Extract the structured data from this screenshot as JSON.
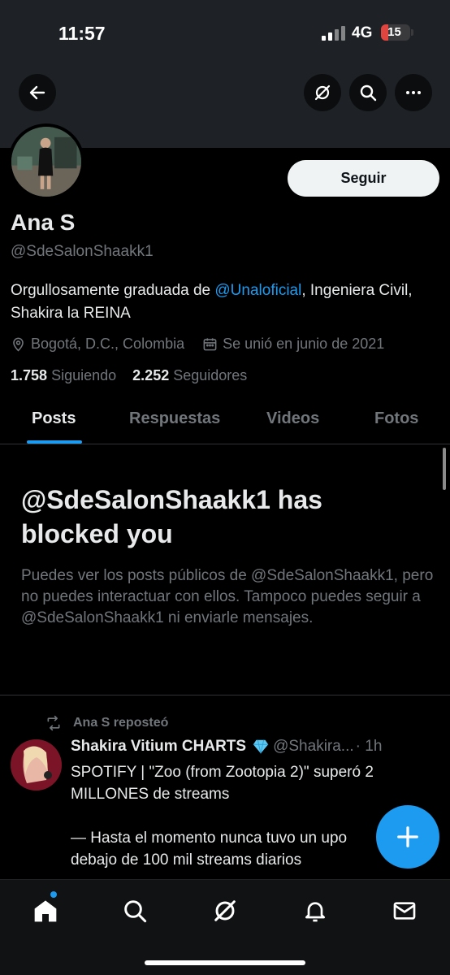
{
  "status_bar": {
    "time": "11:57",
    "network": "4G",
    "battery": "15"
  },
  "profile": {
    "display_name": "Ana S",
    "handle": "@SdeSalonShaakk1",
    "follow_label": "Seguir",
    "bio_prefix": "Orgullosamente graduada de ",
    "bio_mention": "@Unaloficial",
    "bio_suffix": ", Ingeniera Civil, Shakira la REINA",
    "location": "Bogotá, D.C., Colombia",
    "joined": "Se unió en junio de 2021",
    "following_count": "1.758",
    "following_label": "Siguiendo",
    "followers_count": "2.252",
    "followers_label": "Seguidores"
  },
  "tabs": [
    {
      "label": "Posts",
      "active": true
    },
    {
      "label": "Respuestas",
      "active": false
    },
    {
      "label": "Videos",
      "active": false
    },
    {
      "label": "Fotos",
      "active": false
    }
  ],
  "blocked": {
    "title": "@SdeSalonShaakk1 has blocked you",
    "body": "Puedes ver los posts públicos de @SdeSalonShaakk1, pero no puedes interactuar con ellos. Tampoco puedes seguir a @SdeSalonShaakk1 ni enviarle mensajes."
  },
  "post": {
    "repost_label": "Ana S reposteó",
    "author": "Shakira Vitium CHARTS",
    "handle": "@Shakira...",
    "time": "· 1h",
    "text": "SPOTIFY | \"Zoo (from Zootopia 2)\" superó 2 MILLONES de streams\n\n— Hasta el momento nunca tuvo un upo\ndebajo de 100 mil streams diarios"
  },
  "colors": {
    "accent": "#1d9bf0",
    "background": "#000000",
    "muted": "#71767b",
    "text": "#e7e9ea",
    "battery_low": "#e0463f"
  },
  "icons": {
    "back": "arrow-left-icon",
    "grok": "grok-icon",
    "search": "search-icon",
    "more": "more-icon",
    "location": "location-pin-icon",
    "calendar": "calendar-icon",
    "repost": "repost-icon",
    "verified": "diamond-icon",
    "compose": "plus-icon",
    "nav": [
      "home-icon",
      "search-icon",
      "grok-icon",
      "bell-icon",
      "mail-icon"
    ]
  }
}
